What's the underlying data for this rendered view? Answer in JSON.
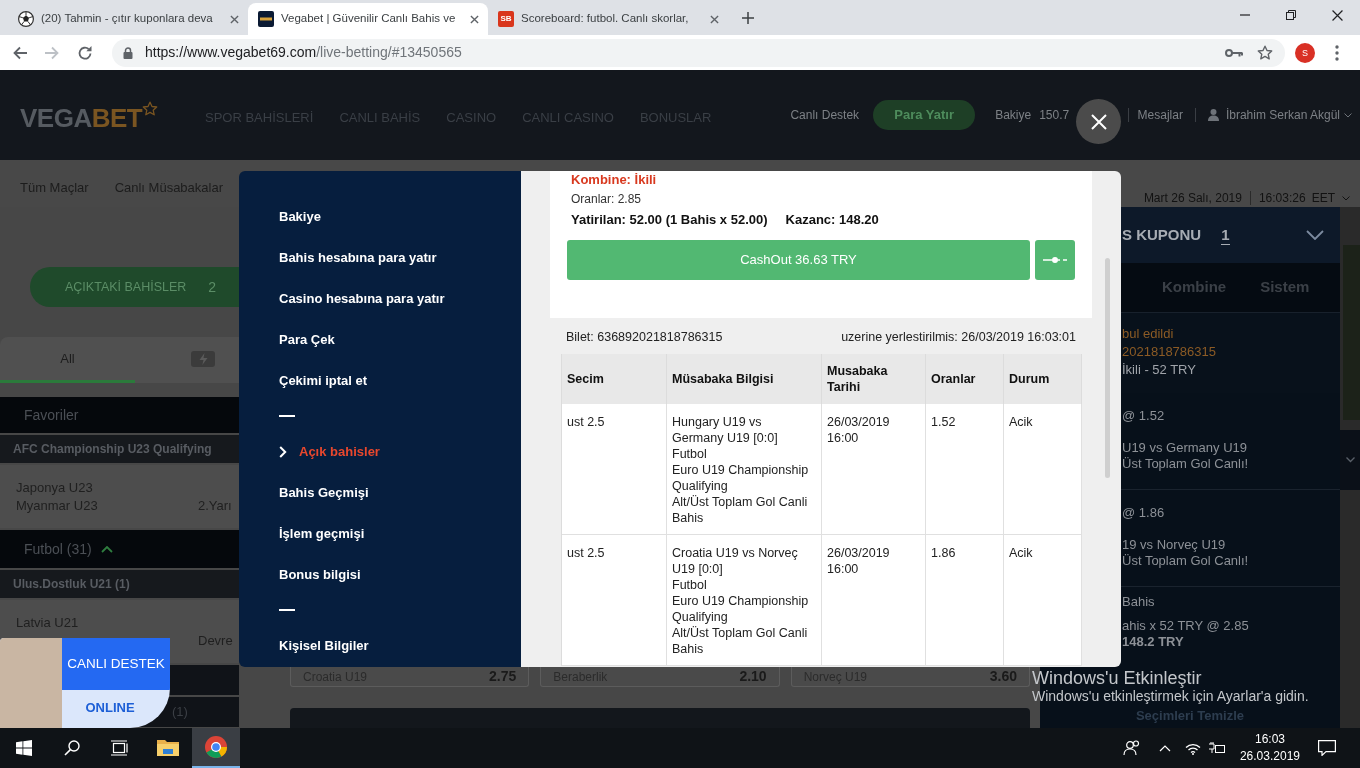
{
  "browser": {
    "tabs": [
      {
        "kind": "ball",
        "title": "(20) Tahmin - çıtır kuponlara deva",
        "selected": false
      },
      {
        "kind": "logo",
        "title": "Vegabet | Güvenilir Canlı Bahis ve",
        "selected": true
      },
      {
        "kind": "letters",
        "favicon_text": "SB",
        "title": "Scoreboard: futbol. Canlı skorlar,",
        "selected": false
      }
    ],
    "url": {
      "host": "https://www.vegabet69.com",
      "path": "/live-betting/#13450565"
    },
    "profile_initial": "S"
  },
  "site": {
    "logo": {
      "part_1": "VEGA",
      "part_2": "BET"
    },
    "nav": [
      "SPOR BAHİSLERİ",
      "CANLI BAHİS",
      "CASINO",
      "CANLI CASINO",
      "BONUSLAR"
    ],
    "support_link": "Canlı Destek",
    "deposit_button": "Para Yatır",
    "balance": {
      "label": "Bakiye",
      "value": "150.7"
    },
    "messages_link": "Mesajlar",
    "user_name": "İbrahim Serkan Akgül",
    "subnav": [
      {
        "label": "Tüm Maçlar"
      },
      {
        "label": "Canlı Müsabakalar"
      }
    ],
    "clock": {
      "date": "Mart 26 Salı, 2019",
      "time": "16:03:26",
      "zone": "EET"
    }
  },
  "sidebar": {
    "open_bets": {
      "label": "AÇIKTAKİ BAHİSLER",
      "count": "2"
    },
    "filter_tabs": [
      {
        "kind": "text",
        "label": "All",
        "selected": true
      },
      {
        "kind": "icon",
        "selected": false
      }
    ],
    "rows": [
      {
        "kind": "section",
        "label": "Favoriler"
      },
      {
        "kind": "league",
        "label": "AFC Championship U23 Qualifying"
      },
      {
        "kind": "match",
        "team_1": "Japonya U23",
        "team_2": "Myanmar U23",
        "status": "2.Yarı"
      },
      {
        "kind": "sport",
        "label": "Futbol (31)",
        "expanded": true
      },
      {
        "kind": "league",
        "label": "Ulus.Dostluk U21 (1)"
      },
      {
        "kind": "match",
        "team_1": "Latvia U21",
        "status": "Devre"
      },
      {
        "kind": "bar"
      },
      {
        "kind": "bar",
        "label": "(1)"
      }
    ]
  },
  "event_odds": [
    {
      "name": "Croatia U19",
      "odds": "2.75"
    },
    {
      "name": "Beraberlik",
      "odds": "2.10"
    },
    {
      "name": "Norveç U19",
      "odds": "3.60"
    }
  ],
  "bet_slip": {
    "title": "S KUPONU",
    "count": "1",
    "tabs": [
      {
        "label": "Kombine",
        "selected": false
      },
      {
        "label": "Sistem",
        "selected": false
      }
    ],
    "status": "bul edildi",
    "ticket": "2021818786315",
    "bet_type": "İkili - 52 TRY",
    "selections": [
      {
        "odds": "@ 1.52",
        "match": "U19 vs Germany U19",
        "market": "Üst Toplam Gol Canlı!"
      },
      {
        "odds": "@ 1.86",
        "match": "19 vs Norveç U19",
        "market": "Üst Toplam Gol Canlı!"
      }
    ],
    "summary": {
      "label": "Bahis",
      "stake": "ahis x 52 TRY @ 2.85",
      "win": "148.2 TRY"
    },
    "clear_button": "Seçimleri Temizle"
  },
  "modal": {
    "menu": [
      {
        "kind": "link",
        "label": "Bakiye",
        "selected": false
      },
      {
        "kind": "link",
        "label": "Bahis hesabına para yatır",
        "selected": false
      },
      {
        "kind": "link",
        "label": "Casino hesabına para yatır",
        "selected": false
      },
      {
        "kind": "link",
        "label": "Para Çek",
        "selected": false
      },
      {
        "kind": "link",
        "label": "Çekimi iptal et",
        "selected": false
      },
      {
        "kind": "separator"
      },
      {
        "kind": "link",
        "label": "Açık bahisler",
        "selected": true
      },
      {
        "kind": "link",
        "label": "Bahis Geçmişi",
        "selected": false
      },
      {
        "kind": "link",
        "label": "İşlem geçmişi",
        "selected": false
      },
      {
        "kind": "link",
        "label": "Bonus bilgisi",
        "selected": false
      },
      {
        "kind": "separator"
      },
      {
        "kind": "link",
        "label": "Kişisel Bilgiler",
        "selected": false
      }
    ],
    "bet": {
      "type": "Kombine: İkili",
      "odds": "Oranlar: 2.85",
      "stake": "Yatirilan: 52.00 (1 Bahis x 52.00)",
      "win": "Kazanc: 148.20",
      "cashout_button": "CashOut 36.63 TRY",
      "ticket": "Bilet: 636892021818786315",
      "placed": "uzerine yerlestirilmis: 26/03/2019 16:03:01",
      "table": {
        "columns": [
          "Secim",
          "Müsabaka Bilgisi",
          "Musabaka Tarihi",
          "Oranlar",
          "Durum"
        ],
        "rows": [
          {
            "selection": "ust 2.5",
            "match": "Hungary U19 vs Germany U19 [0:0]",
            "sport": "Futbol",
            "league": "Euro U19 Championship Qualifying",
            "market": "Alt/Üst Toplam Gol Canli Bahis",
            "date": "26/03/2019 16:00",
            "odds": "1.52",
            "status": "Acik"
          },
          {
            "selection": "ust 2.5",
            "match": "Croatia U19 vs Norveç U19 [0:0]",
            "sport": "Futbol",
            "league": "Euro U19 Championship Qualifying",
            "market": "Alt/Üst Toplam Gol Canli Bahis",
            "date": "26/03/2019 16:00",
            "odds": "1.86",
            "status": "Acik"
          }
        ]
      }
    }
  },
  "live_support": {
    "title": "CANLI DESTEK",
    "status": "ONLINE"
  },
  "taskbar": {
    "apps": [
      {
        "kind": "folder",
        "selected": false
      },
      {
        "kind": "browser",
        "selected": true
      }
    ],
    "time": "16:03",
    "date": "26.03.2019"
  },
  "activation_notice": {
    "title": "Windows'u Etkinleştir",
    "text": "Windows'u etkinleştirmek için Ayarlar'a gidin."
  }
}
